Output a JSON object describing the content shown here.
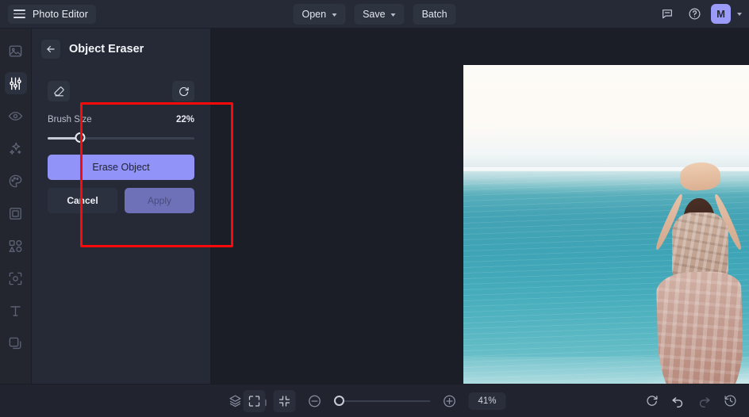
{
  "header": {
    "brand": "Photo Editor",
    "menu_icon": "hamburger-icon",
    "buttons": [
      {
        "label": "Open",
        "has_caret": true
      },
      {
        "label": "Save",
        "has_caret": true
      },
      {
        "label": "Batch",
        "has_caret": false
      }
    ],
    "right_icons": [
      "feedback-chat-icon",
      "help-icon"
    ],
    "avatar_initial": "M"
  },
  "rail": {
    "items": [
      {
        "name": "image-icon",
        "active": false
      },
      {
        "name": "adjustments-icon",
        "active": true
      },
      {
        "name": "eye-icon",
        "active": false
      },
      {
        "name": "magic-sparkle-icon",
        "active": false
      },
      {
        "name": "palette-icon",
        "active": false
      },
      {
        "name": "frame-icon",
        "active": false
      },
      {
        "name": "shapes-icon",
        "active": false
      },
      {
        "name": "object-select-icon",
        "active": false
      },
      {
        "name": "text-icon",
        "active": false
      },
      {
        "name": "layers-stack-icon",
        "active": false
      }
    ]
  },
  "panel": {
    "title": "Object Eraser",
    "back_icon": "arrow-left-icon",
    "tools": {
      "eraser_icon": "eraser-icon",
      "reset_icon": "reset-refresh-icon"
    },
    "brush_size": {
      "label": "Brush Size",
      "value": "22%",
      "percent": 22
    },
    "actions": {
      "primary": "Erase Object",
      "cancel": "Cancel",
      "apply": "Apply",
      "apply_disabled": true
    },
    "highlight_color": "#fb0a09"
  },
  "canvas": {
    "photo_alt": "woman-in-ocean-photo",
    "mask_color": "#d32020",
    "brush_cursor": "brush-circle-cursor"
  },
  "bottombar": {
    "left_icons": [
      "layers-icon",
      "compare-split-icon",
      "grid-view-icon"
    ],
    "center": {
      "fit_icon": "fit-screen-icon",
      "collapse_icon": "collapse-icon",
      "zoom_out_icon": "zoom-out-icon",
      "zoom_in_icon": "zoom-in-icon",
      "zoom_level": "41%",
      "zoom_percent": 6
    },
    "right_icons": [
      "reset-icon",
      "undo-icon",
      "redo-icon",
      "history-icon"
    ]
  }
}
